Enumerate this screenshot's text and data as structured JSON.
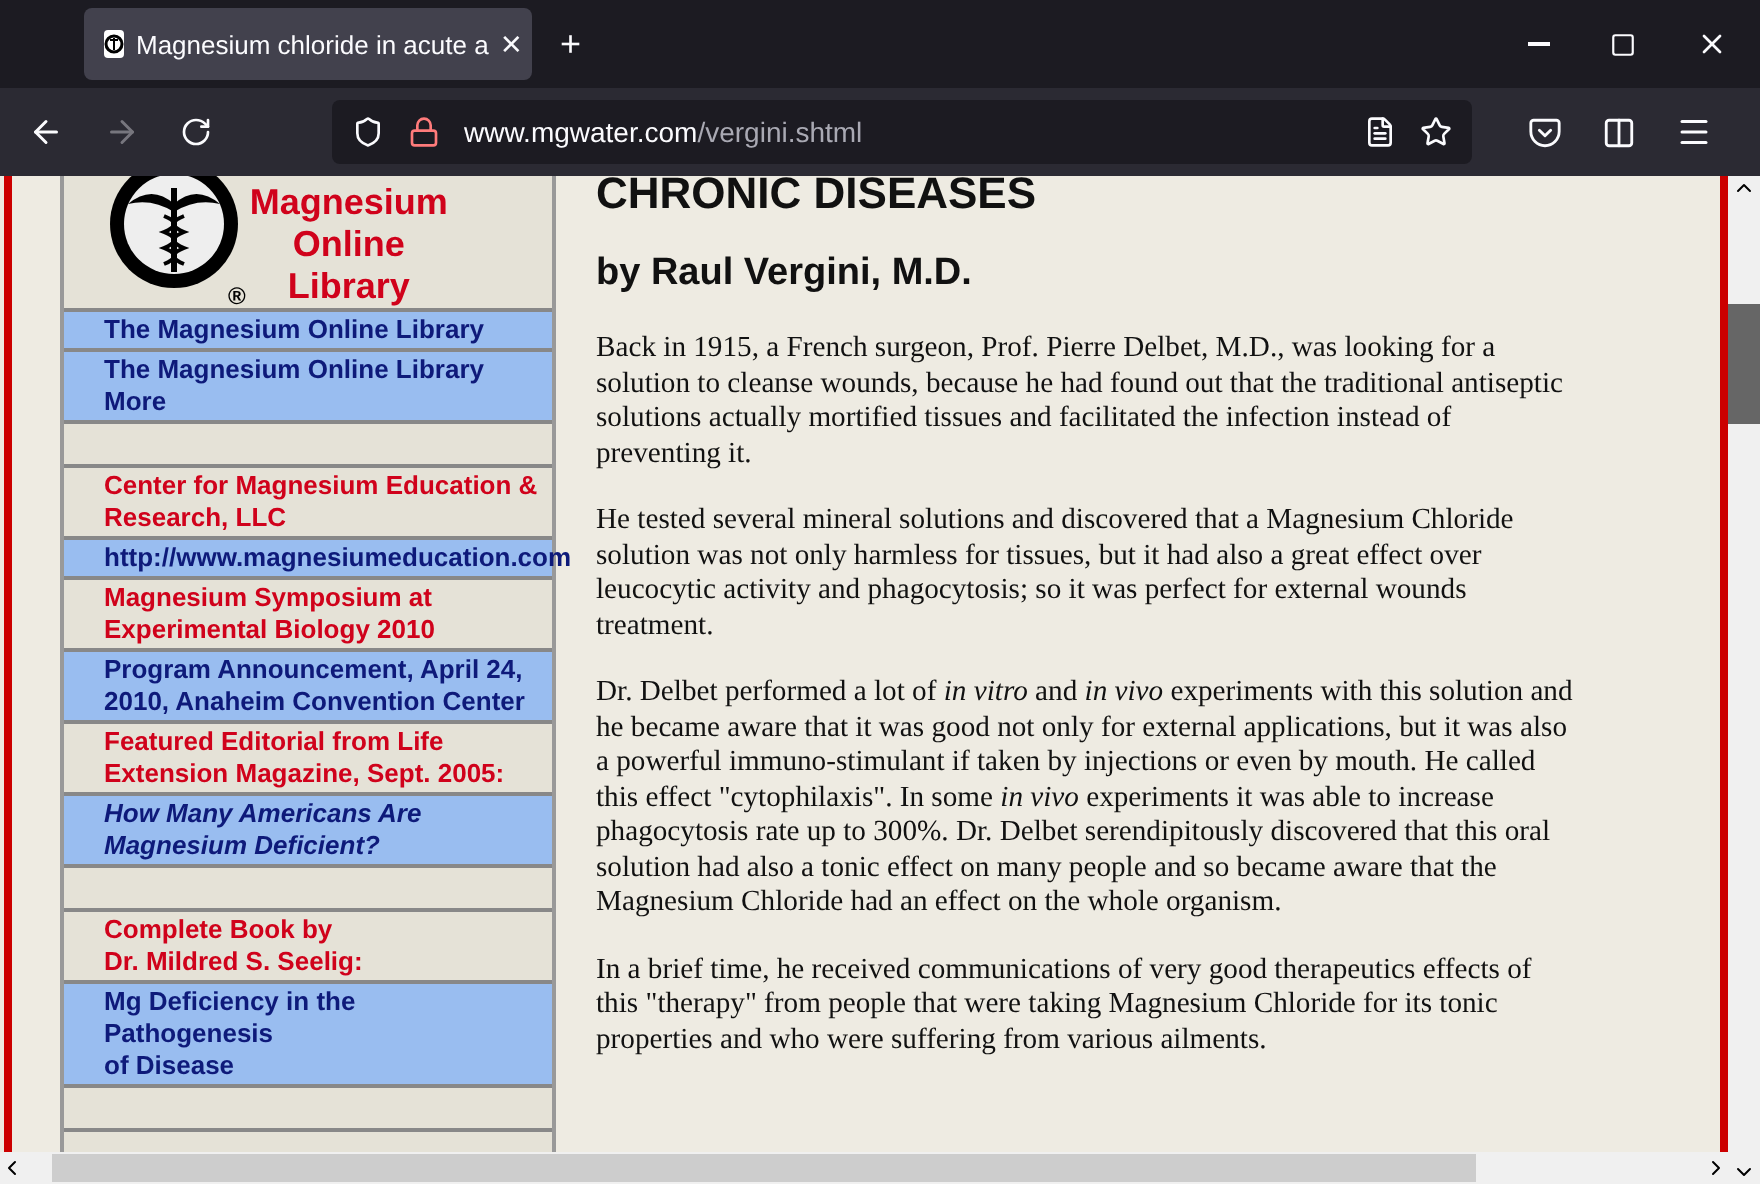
{
  "browser": {
    "tab": {
      "title": "Magnesium chloride in acute a",
      "close": "×"
    },
    "new_tab": "+",
    "url": {
      "host": "www.mgwater.com",
      "path": "/vergini.shtml"
    }
  },
  "sidebar": {
    "logo": {
      "lines": [
        "Magnesium",
        "Online",
        "Library"
      ],
      "registered": "®"
    },
    "items": [
      {
        "kind": "link",
        "text": "The Magnesium Online Library",
        "italic": false
      },
      {
        "kind": "link",
        "text": "The Magnesium Online Library More",
        "italic": false
      },
      {
        "kind": "spacer"
      },
      {
        "kind": "heading",
        "text": "Center for Magnesium Education & Research, LLC"
      },
      {
        "kind": "link",
        "text": "http://www.magnesiumeducation.com",
        "italic": false
      },
      {
        "kind": "heading",
        "text": "Magnesium Symposium at Experimental Biology 2010"
      },
      {
        "kind": "link",
        "text": "Program Announcement, April 24, 2010, Anaheim Convention Center",
        "italic": false
      },
      {
        "kind": "heading",
        "text": "Featured Editorial from Life Extension Magazine, Sept. 2005:"
      },
      {
        "kind": "link",
        "text": "How Many Americans Are Magnesium Deficient?",
        "italic": true
      },
      {
        "kind": "spacer"
      },
      {
        "kind": "heading",
        "text": "Complete Book by\nDr. Mildred S. Seelig:"
      },
      {
        "kind": "link",
        "text": "Mg Deficiency in the\nPathogenesis\nof Disease",
        "italic": false
      },
      {
        "kind": "spacer"
      }
    ]
  },
  "article": {
    "title": "CHRONIC DISEASES",
    "byline": "by Raul Vergini, M.D.",
    "paragraphs": [
      "Back in 1915, a French surgeon, Prof. Pierre Delbet, M.D., was looking for a solution to cleanse wounds, because he had found out that the traditional antiseptic solutions actually mortified tissues and facilitated the infection instead of preventing it.",
      "He tested several mineral solutions and discovered that a Magnesium Chloride solution was not only harmless for tissues, but it had also a great effect over leucocytic activity and phagocytosis; so it was perfect for external wounds treatment.",
      "Dr. Delbet performed a lot of *in vitro* and *in vivo* experiments with this solution and he became aware that it was good not only for external applications, but it was also a powerful immuno-stimulant if taken by injections or even by mouth. He called this effect \"cytophilaxis\". In some *in vivo* experiments it was able to increase phagocytosis rate up to 300%. Dr. Delbet serendipitously discovered that this oral solution had also a tonic effect on many people and so became aware that the Magnesium Chloride had an effect on the whole organism.",
      "In a brief time, he received communications of very good therapeutics effects of this \"therapy\" from people that were taking Magnesium Chloride for its tonic properties and who were suffering from various ailments."
    ]
  }
}
